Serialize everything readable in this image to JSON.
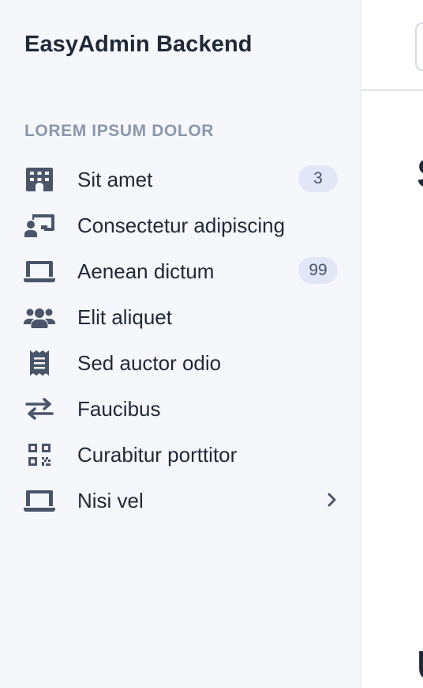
{
  "sidebar": {
    "brand": "EasyAdmin Backend",
    "section_title": "LOREM IPSUM DOLOR",
    "items": [
      {
        "label": "Sit amet",
        "icon": "building-icon",
        "badge": "3"
      },
      {
        "label": "Consectetur adipiscing",
        "icon": "chalkboard-user-icon"
      },
      {
        "label": "Aenean dictum",
        "icon": "laptop-icon",
        "badge": "99"
      },
      {
        "label": "Elit aliquet",
        "icon": "users-icon"
      },
      {
        "label": "Sed auctor odio",
        "icon": "receipt-icon"
      },
      {
        "label": "Faucibus",
        "icon": "exchange-icon"
      },
      {
        "label": "Curabitur porttitor",
        "icon": "qrcode-icon"
      },
      {
        "label": "Nisi vel",
        "icon": "laptop-icon",
        "has_submenu": true
      }
    ]
  },
  "main": {
    "heading_partial": "S",
    "footer_partial": "U"
  },
  "colors": {
    "sidebar_bg": "#f6f7fa",
    "text": "#1f2937",
    "muted": "#8a97ac",
    "icon": "#4a5569",
    "badge_bg": "#e2e7f7"
  }
}
